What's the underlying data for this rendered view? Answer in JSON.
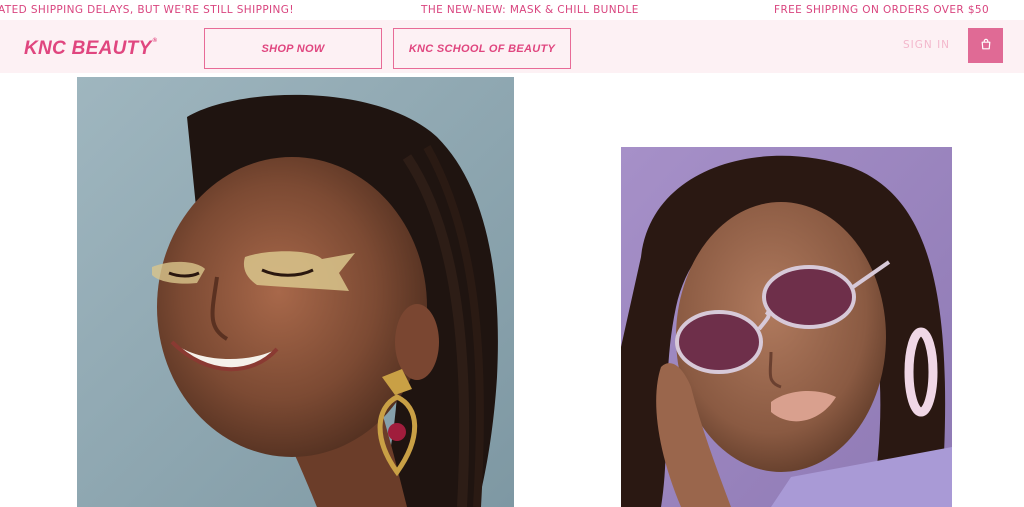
{
  "announcements": [
    "ATED SHIPPING DELAYS, BUT WE'RE STILL SHIPPING!",
    "THE NEW-NEW: MASK & CHILL BUNDLE",
    "FREE SHIPPING ON ORDERS OVER $50"
  ],
  "header": {
    "logo": "KNC BEAUTY",
    "logo_mark": "®",
    "nav": {
      "shop_now": "SHOP NOW",
      "school": "KNC SCHOOL OF BEAUTY"
    },
    "sign_in": "SIGN IN",
    "cart_icon": "shopping-bag-icon"
  },
  "colors": {
    "brand_pink": "#e0467f",
    "header_bg": "#fdf1f4",
    "cart_bg": "#e06a95",
    "signin_pink": "#f3b8cc"
  },
  "images": {
    "left": "model-with-star-eye-masks-photo",
    "right": "model-with-sunglasses-and-lip-mask-photo"
  }
}
